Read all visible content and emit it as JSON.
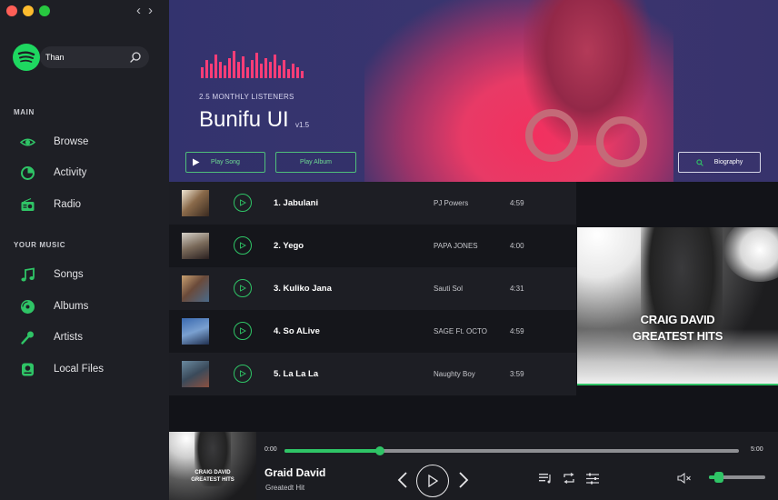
{
  "window": {
    "controls": [
      "close",
      "minimize",
      "maximize"
    ],
    "colors": [
      "#ff5f57",
      "#febc2e",
      "#28c840"
    ]
  },
  "search": {
    "value": "Than"
  },
  "sidebar": {
    "main_title": "MAIN",
    "main_items": [
      {
        "label": "Browse",
        "icon": "eye-icon"
      },
      {
        "label": "Activity",
        "icon": "pie-chart-icon"
      },
      {
        "label": "Radio",
        "icon": "radio-icon"
      }
    ],
    "music_title": "YOUR MUSIC",
    "music_items": [
      {
        "label": "Songs",
        "icon": "music-note-icon"
      },
      {
        "label": "Albums",
        "icon": "disc-icon"
      },
      {
        "label": "Artists",
        "icon": "microphone-icon"
      },
      {
        "label": "Local Files",
        "icon": "local-files-icon"
      }
    ]
  },
  "hero": {
    "listeners": "2.5 MONTHLY LISTENERS",
    "artist": "Bunifu UI",
    "version": "v1.5",
    "play_song": "Play Song",
    "play_album": "Play Album",
    "biography": "Biography"
  },
  "tracks": [
    {
      "title": "1.  Jabulani",
      "artist": "PJ Powers",
      "duration": "4:59"
    },
    {
      "title": "2.  Yego",
      "artist": "PAPA JONES",
      "duration": "4:00"
    },
    {
      "title": "3.  Kuliko Jana",
      "artist": "Sauti Sol",
      "duration": "4:31"
    },
    {
      "title": "4. So ALive",
      "artist": "SAGE Ft. OCTO",
      "duration": "4:59"
    },
    {
      "title": "5.  La La La",
      "artist": "Naughty Boy",
      "duration": "3:59"
    }
  ],
  "album_art": {
    "line1": "CRAIG DAVID",
    "line2": "GREATEST HITS"
  },
  "player": {
    "song": "Graid David",
    "album": "Greatedt Hit",
    "cover_line1": "CRAIG DAVID",
    "cover_line2": "GREATEST HITS",
    "time_current": "0:00",
    "time_total": "5:00",
    "progress": 0.21,
    "volume": 0.17
  },
  "colors": {
    "accent": "#2fc466",
    "hero_pink": "#ff3d77",
    "sidebar": "#1e1f25"
  }
}
